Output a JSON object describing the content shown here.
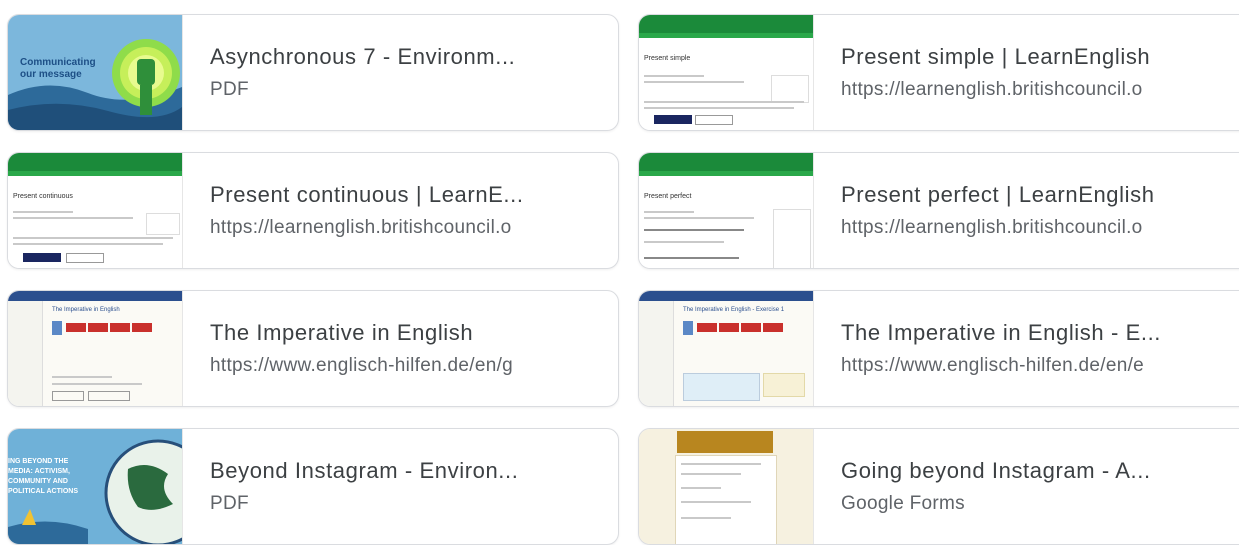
{
  "cards": [
    {
      "title": "Asynchronous 7 - Environm...",
      "subtitle": "PDF",
      "thumb_text": "Communicating our message"
    },
    {
      "title": "Present simple | LearnEnglish",
      "subtitle": "https://learnenglish.britishcouncil.o",
      "thumb_heading": "Present simple"
    },
    {
      "title": "Present continuous | LearnE...",
      "subtitle": "https://learnenglish.britishcouncil.o",
      "thumb_heading": "Present continuous"
    },
    {
      "title": "Present perfect | LearnEnglish",
      "subtitle": "https://learnenglish.britishcouncil.o",
      "thumb_heading": "Present perfect"
    },
    {
      "title": "The Imperative in English",
      "subtitle": "https://www.englisch-hilfen.de/en/g",
      "thumb_heading": "The Imperative in English"
    },
    {
      "title": "The Imperative in English - E...",
      "subtitle": "https://www.englisch-hilfen.de/en/e",
      "thumb_heading": "The Imperative in English - Exercise 1"
    },
    {
      "title": "Beyond Instagram - Environ...",
      "subtitle": "PDF",
      "thumb_text": "ING BEYOND THE MEDIA: ACTIVISM, COMMUNITY AND POLITICAL ACTIONS"
    },
    {
      "title": "Going beyond Instagram - A...",
      "subtitle": "Google Forms"
    }
  ],
  "colors": {
    "title": "#3c4043",
    "subtitle": "#5f6368",
    "british_council_green": "#1b8a3a",
    "env_blue": "#7fb8da"
  }
}
